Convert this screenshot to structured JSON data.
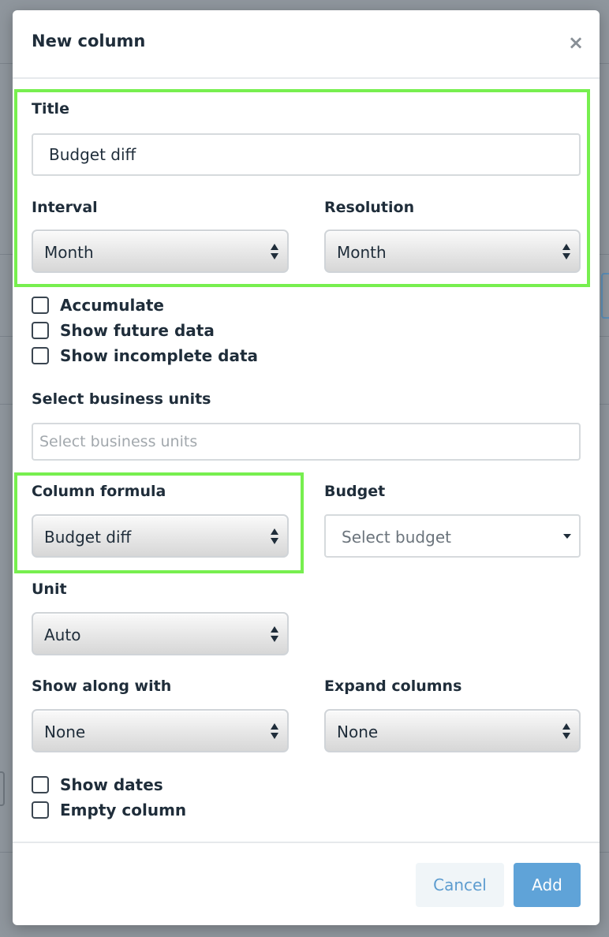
{
  "modal": {
    "title": "New column",
    "close_glyph": "×",
    "close_icon": "close-icon"
  },
  "title_field": {
    "label": "Title",
    "value": "Budget diff"
  },
  "interval": {
    "label": "Interval",
    "value": "Month"
  },
  "resolution": {
    "label": "Resolution",
    "value": "Month"
  },
  "checkboxes_top": [
    {
      "label": "Accumulate",
      "checked": false
    },
    {
      "label": "Show future data",
      "checked": false
    },
    {
      "label": "Show incomplete data",
      "checked": false
    }
  ],
  "business_units": {
    "label": "Select business units",
    "placeholder": "Select business units"
  },
  "column_formula": {
    "label": "Column formula",
    "value": "Budget diff"
  },
  "budget": {
    "label": "Budget",
    "placeholder": "Select budget",
    "caret_icon": "caret-down-icon"
  },
  "unit": {
    "label": "Unit",
    "value": "Auto"
  },
  "show_along_with": {
    "label": "Show along with",
    "value": "None"
  },
  "expand_columns": {
    "label": "Expand columns",
    "value": "None"
  },
  "checkboxes_bottom": [
    {
      "label": "Show dates",
      "checked": false
    },
    {
      "label": "Empty column",
      "checked": false
    }
  ],
  "footer": {
    "cancel_label": "Cancel",
    "add_label": "Add"
  },
  "colors": {
    "highlight": "#77ef4f",
    "primary": "#5fa3d8",
    "overlay": "#8f969d"
  }
}
